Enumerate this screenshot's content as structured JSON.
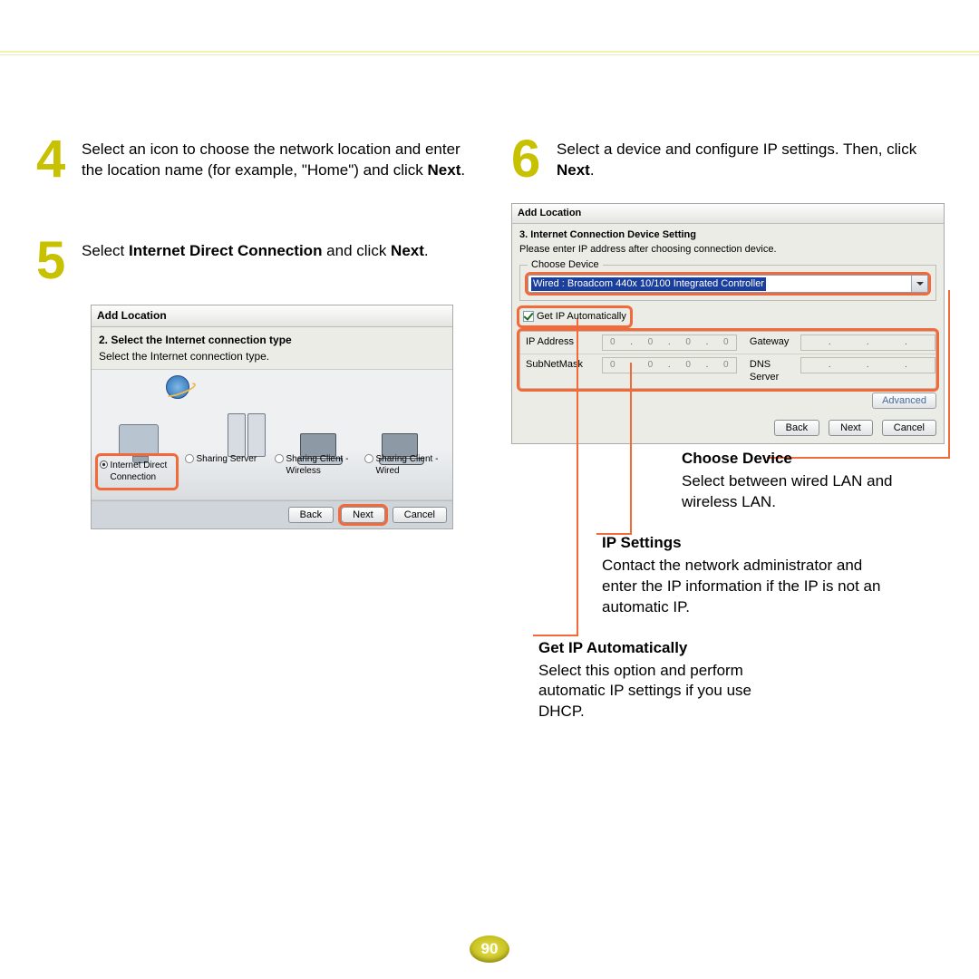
{
  "page_number": "90",
  "step4": {
    "num": "4",
    "text_a": "Select an icon to choose the network location and enter the location name (for example, \"Home\") and click ",
    "bold": "Next",
    "text_b": "."
  },
  "step5": {
    "num": "5",
    "text_a": "Select ",
    "bold1": "Internet Direct Connection",
    "text_b": " and click ",
    "bold2": "Next",
    "text_c": "."
  },
  "step6": {
    "num": "6",
    "text_a": "Select a device and configure IP settings. Then, click ",
    "bold": "Next",
    "text_b": "."
  },
  "dlg5": {
    "title": "Add Location",
    "subtitle": "2. Select the Internet connection type",
    "subtext": "Select the Internet connection type.",
    "opts": [
      "Internet Direct Connection",
      "Sharing Server",
      "Sharing Client - Wireless",
      "Sharing Client - Wired"
    ],
    "back": "Back",
    "next": "Next",
    "cancel": "Cancel"
  },
  "dlg6": {
    "title": "Add Location",
    "subtitle": "3. Internet Connection Device Setting",
    "subtext": "Please enter IP address after choosing connection device.",
    "legend": "Choose Device",
    "device": "Wired : Broadcom 440x 10/100 Integrated Controller",
    "getip": "Get IP Automatically",
    "ip_label": "IP Address",
    "subnet_label": "SubNetMask",
    "gateway_label": "Gateway",
    "dns_label": "DNS Server",
    "ip_val": "0",
    "advanced": "Advanced",
    "back": "Back",
    "next": "Next",
    "cancel": "Cancel"
  },
  "anno1": {
    "title": "Choose Device",
    "body": "Select between wired LAN and wireless LAN."
  },
  "anno2": {
    "title": "IP Settings",
    "body": "Contact the network administrator and enter the IP information if the IP is not an automatic IP."
  },
  "anno3": {
    "title": "Get IP Automatically",
    "body": "Select this option and perform automatic IP settings if you use DHCP."
  }
}
